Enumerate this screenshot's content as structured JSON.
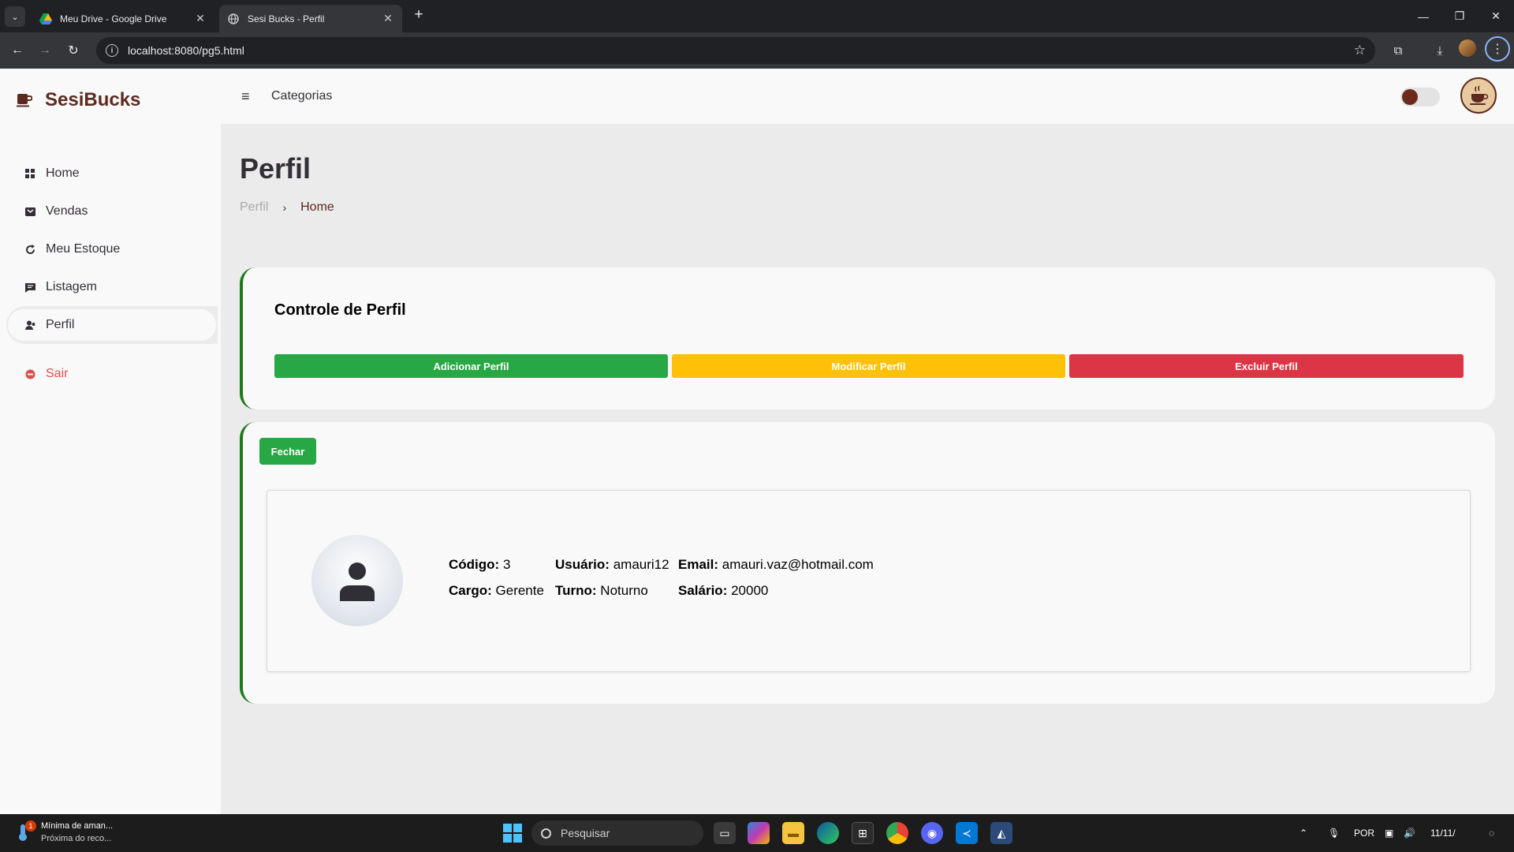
{
  "browser": {
    "tabs": [
      {
        "title": "Meu Drive - Google Drive",
        "icon": "google-drive-icon",
        "active": false
      },
      {
        "title": "Sesi Bucks - Perfil",
        "icon": "globe-icon",
        "active": true
      }
    ],
    "url": "localhost:8080/pg5.html"
  },
  "app": {
    "brand": "SesiBucks",
    "brand_color": "#5c2a1f",
    "topnav": {
      "categories": "Categorias"
    },
    "sidebar": {
      "items": [
        {
          "label": "Home",
          "icon": "dashboard-icon"
        },
        {
          "label": "Vendas",
          "icon": "shopping-bag-icon"
        },
        {
          "label": "Meu Estoque",
          "icon": "refresh-icon"
        },
        {
          "label": "Listagem",
          "icon": "message-icon"
        },
        {
          "label": "Perfil",
          "icon": "user-icon"
        }
      ],
      "active": "Perfil",
      "logout": {
        "label": "Sair",
        "icon": "logout-icon",
        "color": "#db504a"
      }
    }
  },
  "main": {
    "title": "Perfil",
    "breadcrumb": [
      "Perfil",
      "Home"
    ],
    "control_card": {
      "title": "Controle de Perfil",
      "buttons": [
        {
          "label": "Adicionar Perfil",
          "color": "#28a745"
        },
        {
          "label": "Modificar Perfil",
          "color": "#ffc107"
        },
        {
          "label": "Excluir Perfil",
          "color": "#dc3545"
        }
      ]
    },
    "profile_card": {
      "close_label": "Fechar",
      "fields": [
        {
          "label": "Código:",
          "value": "3"
        },
        {
          "label": "Usuário:",
          "value": "amauri12"
        },
        {
          "label": "Email:",
          "value": "amauri.vaz@hotmail.com"
        },
        {
          "label": "Cargo:",
          "value": "Gerente"
        },
        {
          "label": "Turno:",
          "value": "Noturno"
        },
        {
          "label": "Salário:",
          "value": "20000"
        }
      ]
    }
  },
  "taskbar": {
    "weather_title": "Mínima de aman...",
    "weather_sub": "Próxima do reco...",
    "weather_badge": "1",
    "search_placeholder": "Pesquisar",
    "language": "POR",
    "date": "11/11/"
  }
}
